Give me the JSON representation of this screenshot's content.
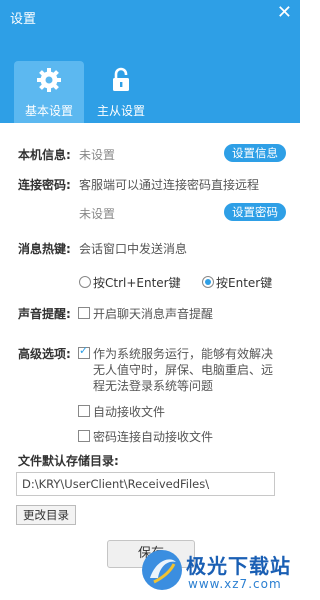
{
  "window": {
    "title": "设置",
    "close_glyph": "✕"
  },
  "tabs": [
    {
      "label": "基本设置",
      "icon": "gear-icon",
      "active": true
    },
    {
      "label": "主从设置",
      "icon": "unlock-icon",
      "active": false
    }
  ],
  "local_info": {
    "label": "本机信息:",
    "value": "未设置",
    "button": "设置信息"
  },
  "connect_password": {
    "label": "连接密码:",
    "description": "客服端可以通过连接密码直接远程",
    "value": "未设置",
    "button": "设置密码"
  },
  "hotkey": {
    "label": "消息热键:",
    "description": "会话窗口中发送消息",
    "option_ctrl": "按Ctrl+Enter键",
    "option_enter": "按Enter键",
    "selected": "按Enter键"
  },
  "sound": {
    "label": "声音提醒:",
    "option": "开启聊天消息声音提醒",
    "checked": false
  },
  "advanced": {
    "label": "高级选项:",
    "service_lines": [
      "作为系统服务运行，能够有效解决",
      "无人值守时，屏保、电脑重启、远",
      "程无法登录系统等问题"
    ],
    "service_checked": true,
    "auto_receive": "自动接收文件",
    "auto_receive_checked": false,
    "pwd_auto_receive": "密码连接自动接收文件",
    "pwd_auto_receive_checked": false
  },
  "storage": {
    "label": "文件默认存储目录:",
    "path": "D:\\KRY\\UserClient\\ReceivedFiles\\",
    "change_button": "更改目录"
  },
  "save_button": "保存",
  "watermark": {
    "name": "极光下载站",
    "url": "www.xz7.com"
  },
  "colors": {
    "accent": "#2e9fe6",
    "tab_active": "#5cb8f0"
  }
}
